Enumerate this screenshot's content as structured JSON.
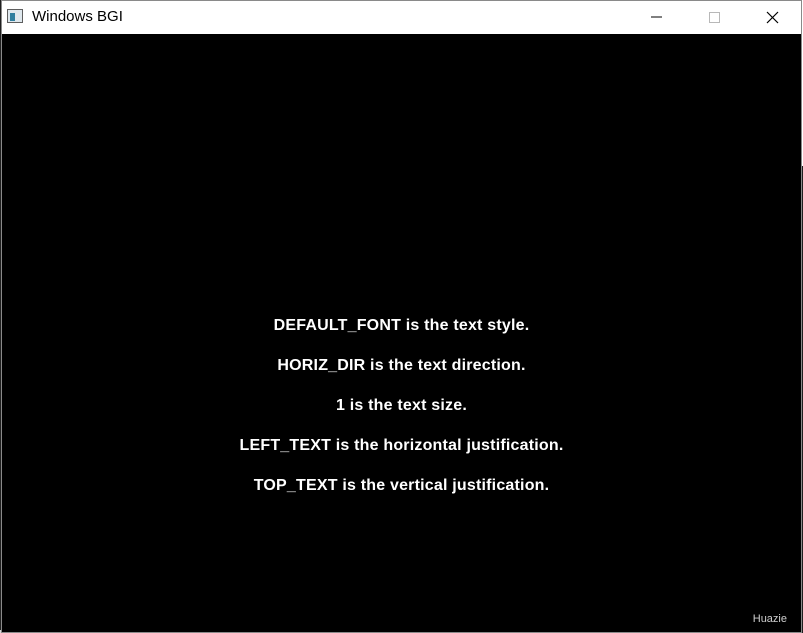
{
  "window": {
    "title": "Windows BGI",
    "controls": {
      "minimize": "minimize-icon",
      "maximize": "maximize-icon",
      "close": "close-icon"
    }
  },
  "canvas": {
    "background": "#000000",
    "text_color": "#ffffff",
    "lines": [
      "DEFAULT_FONT is the text style.",
      "HORIZ_DIR is the text direction.",
      "1 is the text size.",
      "LEFT_TEXT is the horizontal justification.",
      "TOP_TEXT is the vertical justification."
    ]
  },
  "watermark": "Huazie"
}
